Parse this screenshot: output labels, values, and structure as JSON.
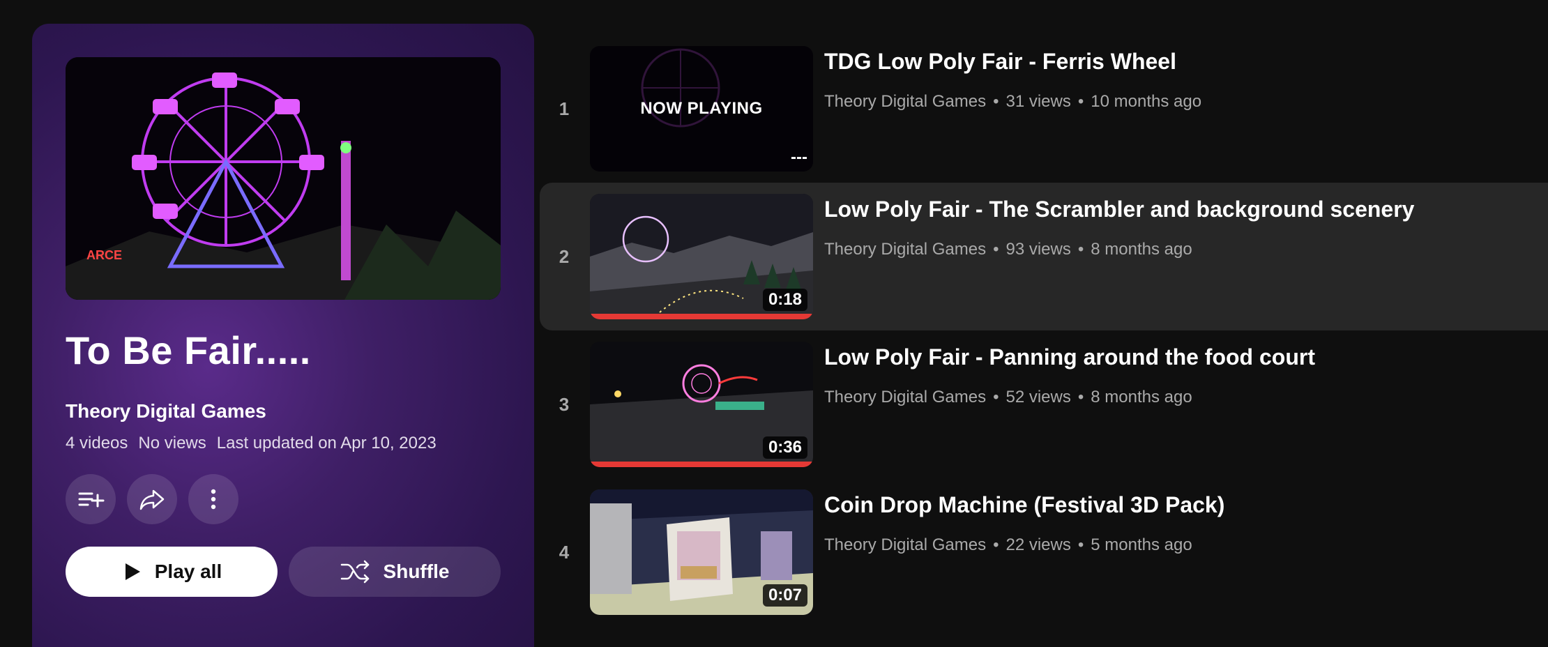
{
  "playlist": {
    "title": "To Be Fair.....",
    "owner": "Theory Digital Games",
    "video_count": "4 videos",
    "views": "No views",
    "updated": "Last updated on Apr 10, 2023",
    "play_all_label": "Play all",
    "shuffle_label": "Shuffle",
    "icons": [
      "save-to-library-icon",
      "share-icon",
      "more-options-icon",
      "play-icon",
      "shuffle-icon"
    ],
    "accent": "#3f1f66"
  },
  "videos": [
    {
      "index": "1",
      "title": "TDG Low Poly Fair - Ferris Wheel",
      "channel": "Theory Digital Games",
      "sep": "•",
      "views": "31 views",
      "dot": "•",
      "age": "10 months ago",
      "overlay": "NOW PLAYING",
      "duration": "---"
    },
    {
      "index": "2",
      "title": "Low Poly Fair - The Scrambler and background scenery",
      "channel": "Theory Digital Games",
      "sep": "•",
      "views": "93 views",
      "dot": "•",
      "age": "8 months ago",
      "duration": "0:18",
      "watched": 1.0
    },
    {
      "index": "3",
      "title": "Low Poly Fair - Panning around the food court",
      "channel": "Theory Digital Games",
      "sep": "•",
      "views": "52 views",
      "dot": "•",
      "age": "8 months ago",
      "duration": "0:36",
      "watched": 1.0
    },
    {
      "index": "4",
      "title": "Coin Drop Machine (Festival 3D Pack)",
      "channel": "Theory Digital Games",
      "sep": "•",
      "views": "22 views",
      "dot": "•",
      "age": "5 months ago",
      "duration": "0:07"
    }
  ],
  "colors": {
    "background": "#0f0f0f",
    "progress": "#e53935",
    "hover_row": "#272727"
  }
}
